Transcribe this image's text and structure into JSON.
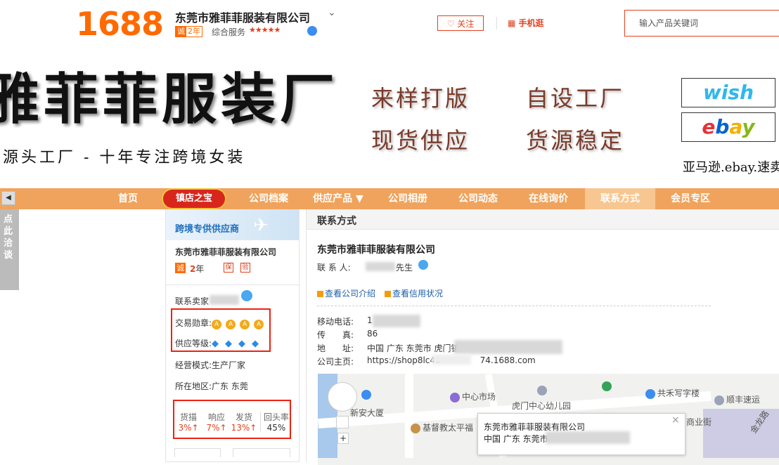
{
  "header": {
    "logo": "1688",
    "company_name": "东莞市雅菲菲服装有限公司",
    "cheng_label": "诚",
    "cheng_years": "2年",
    "service_label": "综合服务",
    "stars": "★★★★★",
    "follow_label": "关注",
    "mobile_label": "手机逛",
    "search_placeholder": "输入产品关键词"
  },
  "banner": {
    "title": "雅菲菲服装厂",
    "slogan": "源头工厂 - 十年专注跨境女装",
    "features": [
      "来样打版",
      "自设工厂",
      "现货供应",
      "货源稳定"
    ],
    "wish": "wish",
    "ebay": [
      "e",
      "b",
      "a",
      "y"
    ],
    "platforms": "亚马逊.ebay.速卖"
  },
  "nav": {
    "items": [
      "首页",
      "镇店之宝",
      "公司档案",
      "供应产品 ▼",
      "公司相册",
      "公司动态",
      "在线询价",
      "联系方式",
      "会员专区"
    ],
    "active_index": 7
  },
  "side_tab": {
    "label": "点此洽谈",
    "arrow": "◀"
  },
  "left_panel": {
    "supplier_banner": "跨境专供供应商",
    "company": "东莞市雅菲菲服装有限公司",
    "cheng": "诚",
    "years_num": "2",
    "years_unit": "年",
    "icon1": "保",
    "icon2": "验",
    "contact_label": "联系卖家",
    "trade_medal_label": "交易勋章:",
    "medal_glyph": "A",
    "supply_level_label": "供应等级:",
    "gem_glyph": "◆",
    "business_model": "经营模式:生产厂家",
    "region": "所在地区:广东 东莞",
    "stats": [
      {
        "label": "货描",
        "value": "3%↑"
      },
      {
        "label": "响应",
        "value": "7%↑"
      },
      {
        "label": "发货",
        "value": "13%↑"
      },
      {
        "label": "回头率",
        "value": "45%"
      }
    ]
  },
  "main": {
    "section_title": "联系方式",
    "company": "东莞市雅菲菲服装有限公司",
    "contact_label": "联 系 人:",
    "contact_name": "先生",
    "link_intro": "查看公司介绍",
    "link_credit": "查看信用状况",
    "mobile_label": "移动电话:",
    "mobile_value": "1",
    "fax_label": "传　　真:",
    "fax_value": "86",
    "address_label": "地　　址:",
    "address_value": "中国 广东 东莞市 虎门镇",
    "homepage_label": "公司主页:",
    "homepage_url": "https://shop8lc48        74.1688.com",
    "homepage_url_a": "https://shop8lc48",
    "homepage_url_b": "74.1688.com"
  },
  "map": {
    "pois": [
      "中心市场",
      "虎门中心幼儿园",
      "共禾写字楼",
      "顺丰速运",
      "新安大厦",
      "基督教太平福",
      "商业街",
      "金龙路"
    ],
    "popup_title": "东莞市雅菲菲服装有限公司",
    "popup_address": "中国 广东 东莞市",
    "close": "×",
    "plus": "+"
  },
  "colors": {
    "brand": "#ff6a00",
    "nav": "#f0a35c",
    "accent_red": "#e2401c",
    "link": "#1f5ea8"
  }
}
